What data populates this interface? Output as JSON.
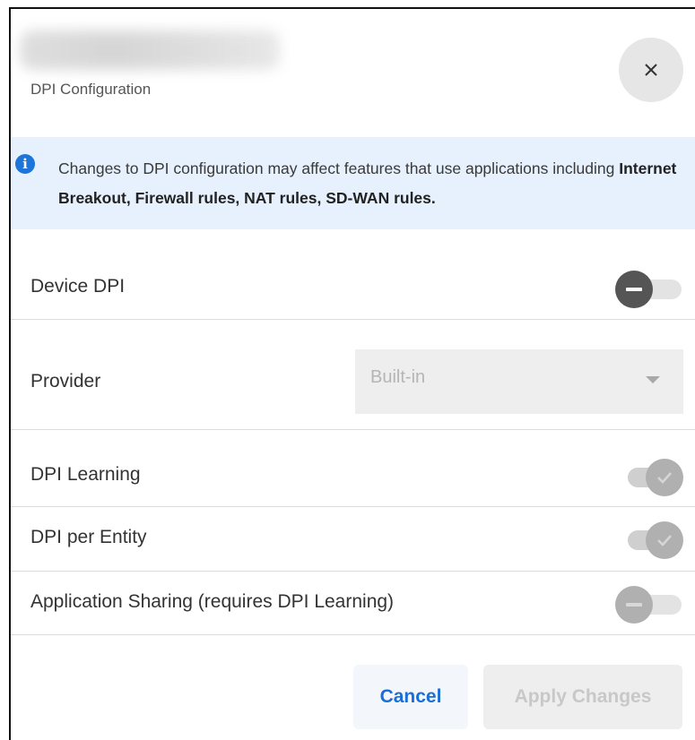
{
  "dialog": {
    "subtitle": "DPI Configuration",
    "close_icon": "close-icon"
  },
  "banner": {
    "icon": "info-icon",
    "text_prefix": "Changes to DPI configuration may affect features that use applications including ",
    "features": "Internet Breakout, Firewall rules, NAT rules, SD-WAN rules."
  },
  "settings": {
    "device_dpi": {
      "label": "Device DPI",
      "state": "off"
    },
    "provider": {
      "label": "Provider",
      "selected": "Built-in",
      "disabled": true
    },
    "dpi_learning": {
      "label": "DPI Learning",
      "state": "on",
      "disabled": true
    },
    "dpi_per_entity": {
      "label": "DPI per Entity",
      "state": "on",
      "disabled": true
    },
    "application_sharing": {
      "label": "Application Sharing (requires DPI Learning)",
      "state": "off",
      "disabled": true
    }
  },
  "footer": {
    "cancel_label": "Cancel",
    "apply_label": "Apply Changes"
  },
  "colors": {
    "accent": "#1a6fd6",
    "banner_bg": "#e6f1fd",
    "info_icon": "#1d74d9",
    "toggle_off_dark": "#555555",
    "toggle_disabled": "#b0b0b0"
  }
}
